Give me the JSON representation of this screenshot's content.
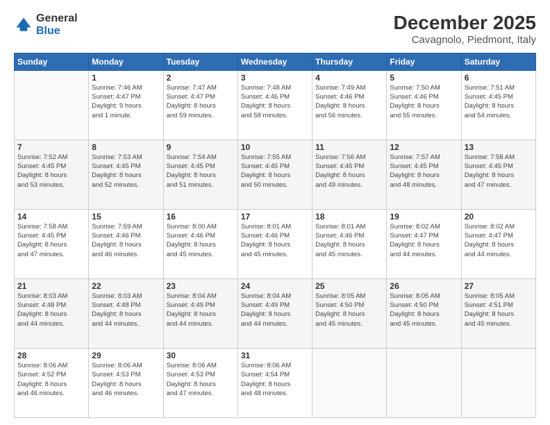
{
  "logo": {
    "general": "General",
    "blue": "Blue"
  },
  "title": "December 2025",
  "subtitle": "Cavagnolo, Piedmont, Italy",
  "weekdays": [
    "Sunday",
    "Monday",
    "Tuesday",
    "Wednesday",
    "Thursday",
    "Friday",
    "Saturday"
  ],
  "weeks": [
    [
      {
        "day": "",
        "info": ""
      },
      {
        "day": "1",
        "info": "Sunrise: 7:46 AM\nSunset: 4:47 PM\nDaylight: 9 hours\nand 1 minute."
      },
      {
        "day": "2",
        "info": "Sunrise: 7:47 AM\nSunset: 4:47 PM\nDaylight: 8 hours\nand 59 minutes."
      },
      {
        "day": "3",
        "info": "Sunrise: 7:48 AM\nSunset: 4:46 PM\nDaylight: 8 hours\nand 58 minutes."
      },
      {
        "day": "4",
        "info": "Sunrise: 7:49 AM\nSunset: 4:46 PM\nDaylight: 8 hours\nand 56 minutes."
      },
      {
        "day": "5",
        "info": "Sunrise: 7:50 AM\nSunset: 4:46 PM\nDaylight: 8 hours\nand 55 minutes."
      },
      {
        "day": "6",
        "info": "Sunrise: 7:51 AM\nSunset: 4:45 PM\nDaylight: 8 hours\nand 54 minutes."
      }
    ],
    [
      {
        "day": "7",
        "info": "Sunrise: 7:52 AM\nSunset: 4:45 PM\nDaylight: 8 hours\nand 53 minutes."
      },
      {
        "day": "8",
        "info": "Sunrise: 7:53 AM\nSunset: 4:45 PM\nDaylight: 8 hours\nand 52 minutes."
      },
      {
        "day": "9",
        "info": "Sunrise: 7:54 AM\nSunset: 4:45 PM\nDaylight: 8 hours\nand 51 minutes."
      },
      {
        "day": "10",
        "info": "Sunrise: 7:55 AM\nSunset: 4:45 PM\nDaylight: 8 hours\nand 50 minutes."
      },
      {
        "day": "11",
        "info": "Sunrise: 7:56 AM\nSunset: 4:45 PM\nDaylight: 8 hours\nand 49 minutes."
      },
      {
        "day": "12",
        "info": "Sunrise: 7:57 AM\nSunset: 4:45 PM\nDaylight: 8 hours\nand 48 minutes."
      },
      {
        "day": "13",
        "info": "Sunrise: 7:58 AM\nSunset: 4:45 PM\nDaylight: 8 hours\nand 47 minutes."
      }
    ],
    [
      {
        "day": "14",
        "info": "Sunrise: 7:58 AM\nSunset: 4:45 PM\nDaylight: 8 hours\nand 47 minutes."
      },
      {
        "day": "15",
        "info": "Sunrise: 7:59 AM\nSunset: 4:46 PM\nDaylight: 8 hours\nand 46 minutes."
      },
      {
        "day": "16",
        "info": "Sunrise: 8:00 AM\nSunset: 4:46 PM\nDaylight: 8 hours\nand 45 minutes."
      },
      {
        "day": "17",
        "info": "Sunrise: 8:01 AM\nSunset: 4:46 PM\nDaylight: 8 hours\nand 45 minutes."
      },
      {
        "day": "18",
        "info": "Sunrise: 8:01 AM\nSunset: 4:46 PM\nDaylight: 8 hours\nand 45 minutes."
      },
      {
        "day": "19",
        "info": "Sunrise: 8:02 AM\nSunset: 4:47 PM\nDaylight: 8 hours\nand 44 minutes."
      },
      {
        "day": "20",
        "info": "Sunrise: 8:02 AM\nSunset: 4:47 PM\nDaylight: 8 hours\nand 44 minutes."
      }
    ],
    [
      {
        "day": "21",
        "info": "Sunrise: 8:03 AM\nSunset: 4:48 PM\nDaylight: 8 hours\nand 44 minutes."
      },
      {
        "day": "22",
        "info": "Sunrise: 8:03 AM\nSunset: 4:48 PM\nDaylight: 8 hours\nand 44 minutes."
      },
      {
        "day": "23",
        "info": "Sunrise: 8:04 AM\nSunset: 4:49 PM\nDaylight: 8 hours\nand 44 minutes."
      },
      {
        "day": "24",
        "info": "Sunrise: 8:04 AM\nSunset: 4:49 PM\nDaylight: 8 hours\nand 44 minutes."
      },
      {
        "day": "25",
        "info": "Sunrise: 8:05 AM\nSunset: 4:50 PM\nDaylight: 8 hours\nand 45 minutes."
      },
      {
        "day": "26",
        "info": "Sunrise: 8:05 AM\nSunset: 4:50 PM\nDaylight: 8 hours\nand 45 minutes."
      },
      {
        "day": "27",
        "info": "Sunrise: 8:05 AM\nSunset: 4:51 PM\nDaylight: 8 hours\nand 45 minutes."
      }
    ],
    [
      {
        "day": "28",
        "info": "Sunrise: 8:06 AM\nSunset: 4:52 PM\nDaylight: 8 hours\nand 46 minutes."
      },
      {
        "day": "29",
        "info": "Sunrise: 8:06 AM\nSunset: 4:53 PM\nDaylight: 8 hours\nand 46 minutes."
      },
      {
        "day": "30",
        "info": "Sunrise: 8:06 AM\nSunset: 4:53 PM\nDaylight: 8 hours\nand 47 minutes."
      },
      {
        "day": "31",
        "info": "Sunrise: 8:06 AM\nSunset: 4:54 PM\nDaylight: 8 hours\nand 48 minutes."
      },
      {
        "day": "",
        "info": ""
      },
      {
        "day": "",
        "info": ""
      },
      {
        "day": "",
        "info": ""
      }
    ]
  ]
}
